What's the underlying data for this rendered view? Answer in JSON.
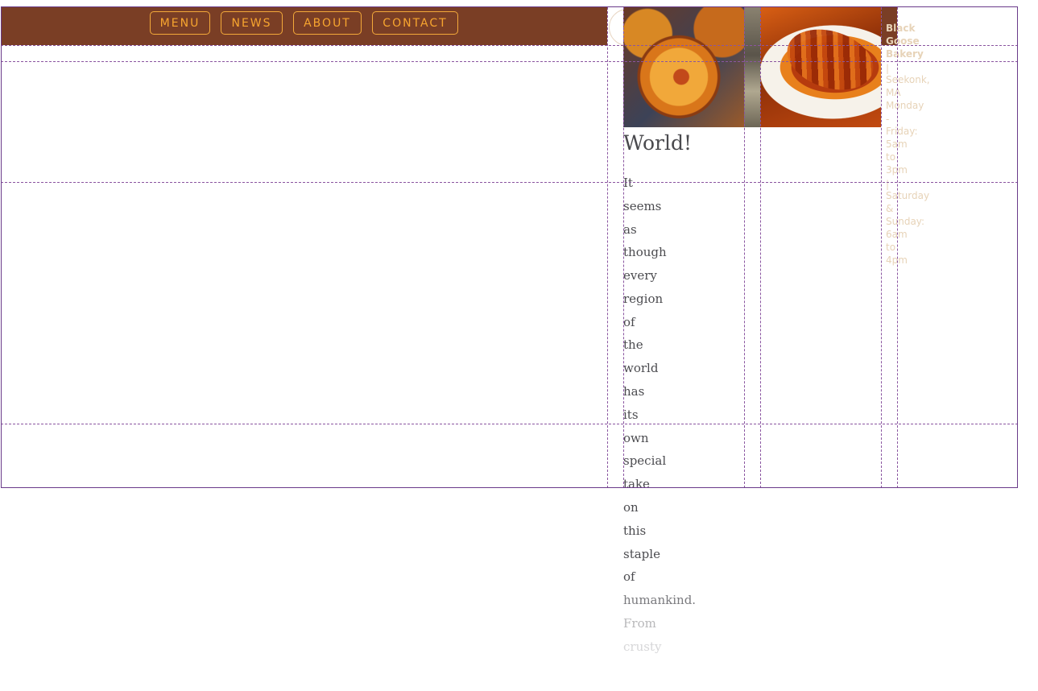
{
  "nav": {
    "items": [
      {
        "label": "MENU"
      },
      {
        "label": "NEWS"
      },
      {
        "label": "ABOUT"
      },
      {
        "label": "CONTACT"
      }
    ]
  },
  "article": {
    "heading": "World!",
    "words": [
      "It",
      "seems",
      "as",
      "though",
      "every",
      "region",
      "of",
      "the",
      "world",
      "has",
      "its",
      "own",
      "special",
      "take",
      "on",
      "this",
      "staple",
      "of",
      "humankind.",
      "From",
      "crusty"
    ]
  },
  "sidebar": {
    "lines": [
      "Black",
      "Goose",
      "Bakery",
      "|",
      "Seekonk,",
      "MA",
      "Monday",
      "-",
      "Friday:",
      "5am",
      "to",
      "3pm",
      "|",
      "Saturday",
      "&",
      "Sunday:",
      "6am",
      "to",
      "4pm"
    ]
  },
  "colors": {
    "header_brown": "#7a3e25",
    "nav_orange": "#f7a52f",
    "guide_purple": "#8a55a0"
  },
  "icons": {
    "logo": "logo-circle-icon"
  }
}
